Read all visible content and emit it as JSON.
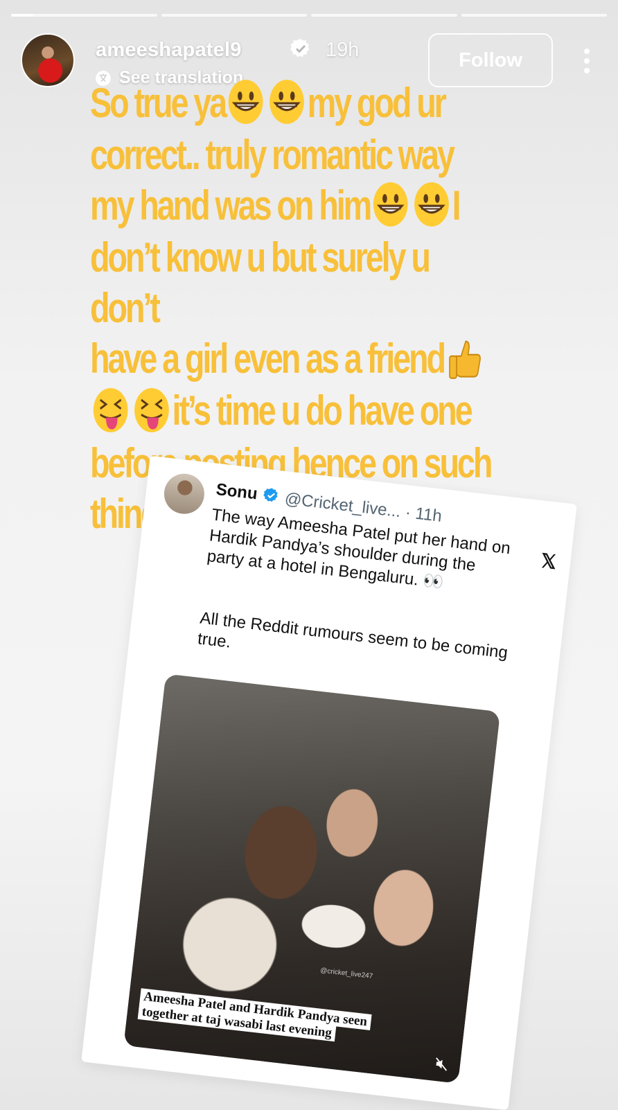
{
  "story": {
    "progress": [
      {
        "fill": 0.15
      },
      {
        "fill": 0
      },
      {
        "fill": 0
      },
      {
        "fill": 0
      }
    ],
    "header": {
      "username": "ameeshapatel9",
      "time": "19h",
      "see_translation": "See translation",
      "follow_label": "Follow",
      "avatar_icon": "profile-avatar",
      "verified_icon": "verified-badge-icon",
      "more_icon": "more-options-icon"
    },
    "caption": {
      "lines": [
        "So true ya",
        "my god ur",
        "correct.. truly romantic way",
        "my hand was on him",
        "I",
        "don’t know u but surely u don’t",
        "have a girl even as a friend",
        "it’s time u do have one",
        "before posting  hence on such",
        "things .."
      ],
      "color": "#f8c03a"
    },
    "tweet": {
      "name": "Sonu",
      "handle": "@Cricket_live... · 11h",
      "x_logo": "𝕏",
      "body_1": "The way Ameesha Patel put her hand on Hardik Pandya’s shoulder during the party at a hotel in Bengaluru. 👀",
      "body_2": "All the Reddit rumours seem to be coming true.",
      "media_watermark": "@cricket_live247",
      "media_caption": "Ameesha Patel and Hardik Pandya seen together at taj wasabi last evening"
    }
  }
}
